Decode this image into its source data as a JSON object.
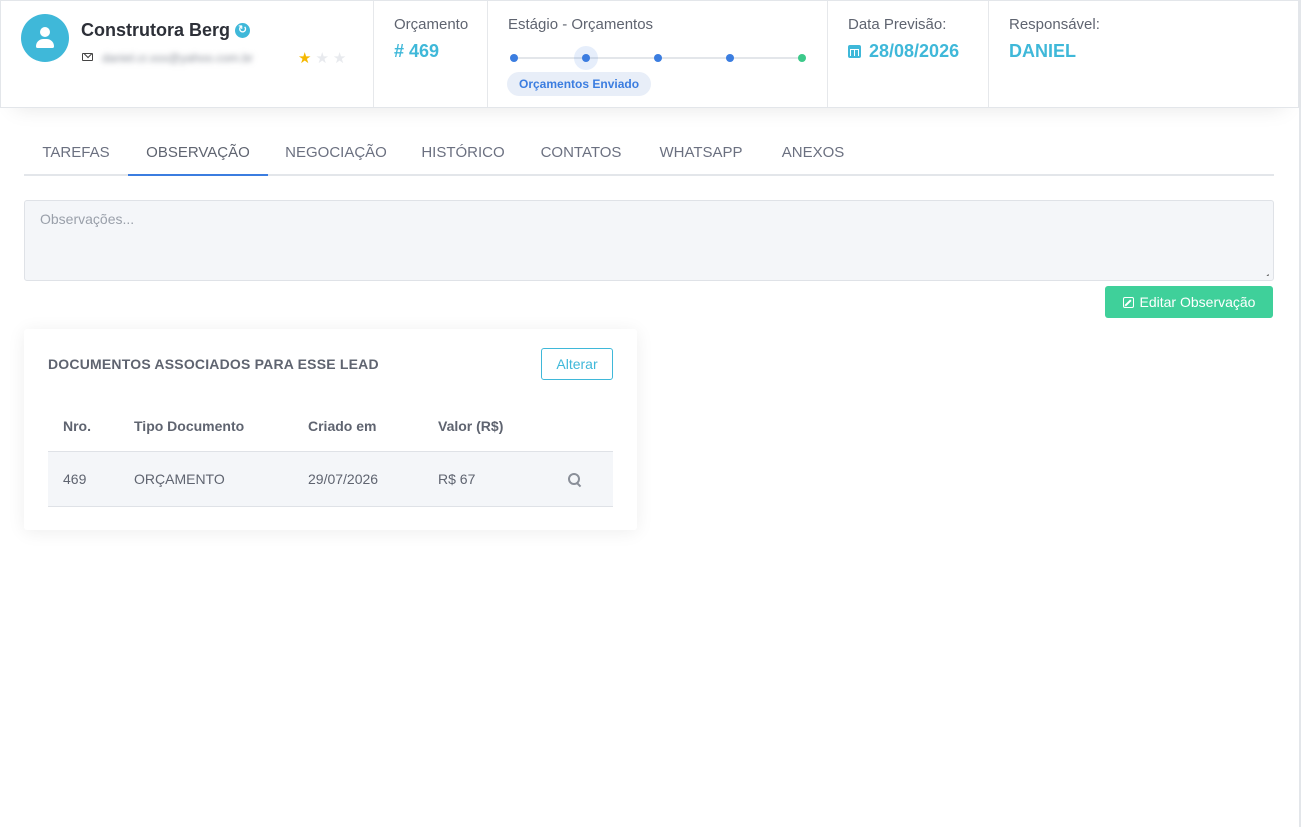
{
  "header": {
    "company_name": "Construtora Berg",
    "email": "daniel.cr.xxx@yahoo.com.br",
    "rating": {
      "value": 1,
      "max": 3
    },
    "orcamento": {
      "label": "Orçamento",
      "value": "# 469"
    },
    "stage": {
      "label": "Estágio - Orçamentos",
      "current": "Orçamentos Enviado",
      "steps_total": 5,
      "active_step": 2
    },
    "date": {
      "label": "Data Previsão:",
      "value": "28/08/2026"
    },
    "responsible": {
      "label": "Responsável:",
      "value": "DANIEL"
    }
  },
  "tabs": [
    {
      "label": "TAREFAS",
      "active": false
    },
    {
      "label": "OBSERVAÇÃO",
      "active": true
    },
    {
      "label": "NEGOCIAÇÃO",
      "active": false
    },
    {
      "label": "HISTÓRICO",
      "active": false
    },
    {
      "label": "CONTATOS",
      "active": false
    },
    {
      "label": "WHATSAPP",
      "active": false
    },
    {
      "label": "ANEXOS",
      "active": false
    }
  ],
  "observation": {
    "placeholder": "Observações...",
    "value": "",
    "edit_label": "Editar Observação"
  },
  "documents": {
    "title": "DOCUMENTOS ASSOCIADOS PARA ESSE LEAD",
    "alter_label": "Alterar",
    "columns": [
      "Nro.",
      "Tipo Documento",
      "Criado em",
      "Valor (R$)"
    ],
    "rows": [
      {
        "nro": "469",
        "tipo": "ORÇAMENTO",
        "criado": "29/07/2026",
        "valor": "R$ 67"
      }
    ]
  },
  "colors": {
    "accent": "#3fb8d9",
    "primary": "#3b7de0",
    "success": "#3fd09a",
    "star": "#f5b800"
  },
  "icons": {
    "avatar": "user-icon",
    "sync": "sync-icon",
    "mail": "mail-icon",
    "calendar": "calendar-icon",
    "edit": "edit-icon",
    "search": "search-icon"
  }
}
